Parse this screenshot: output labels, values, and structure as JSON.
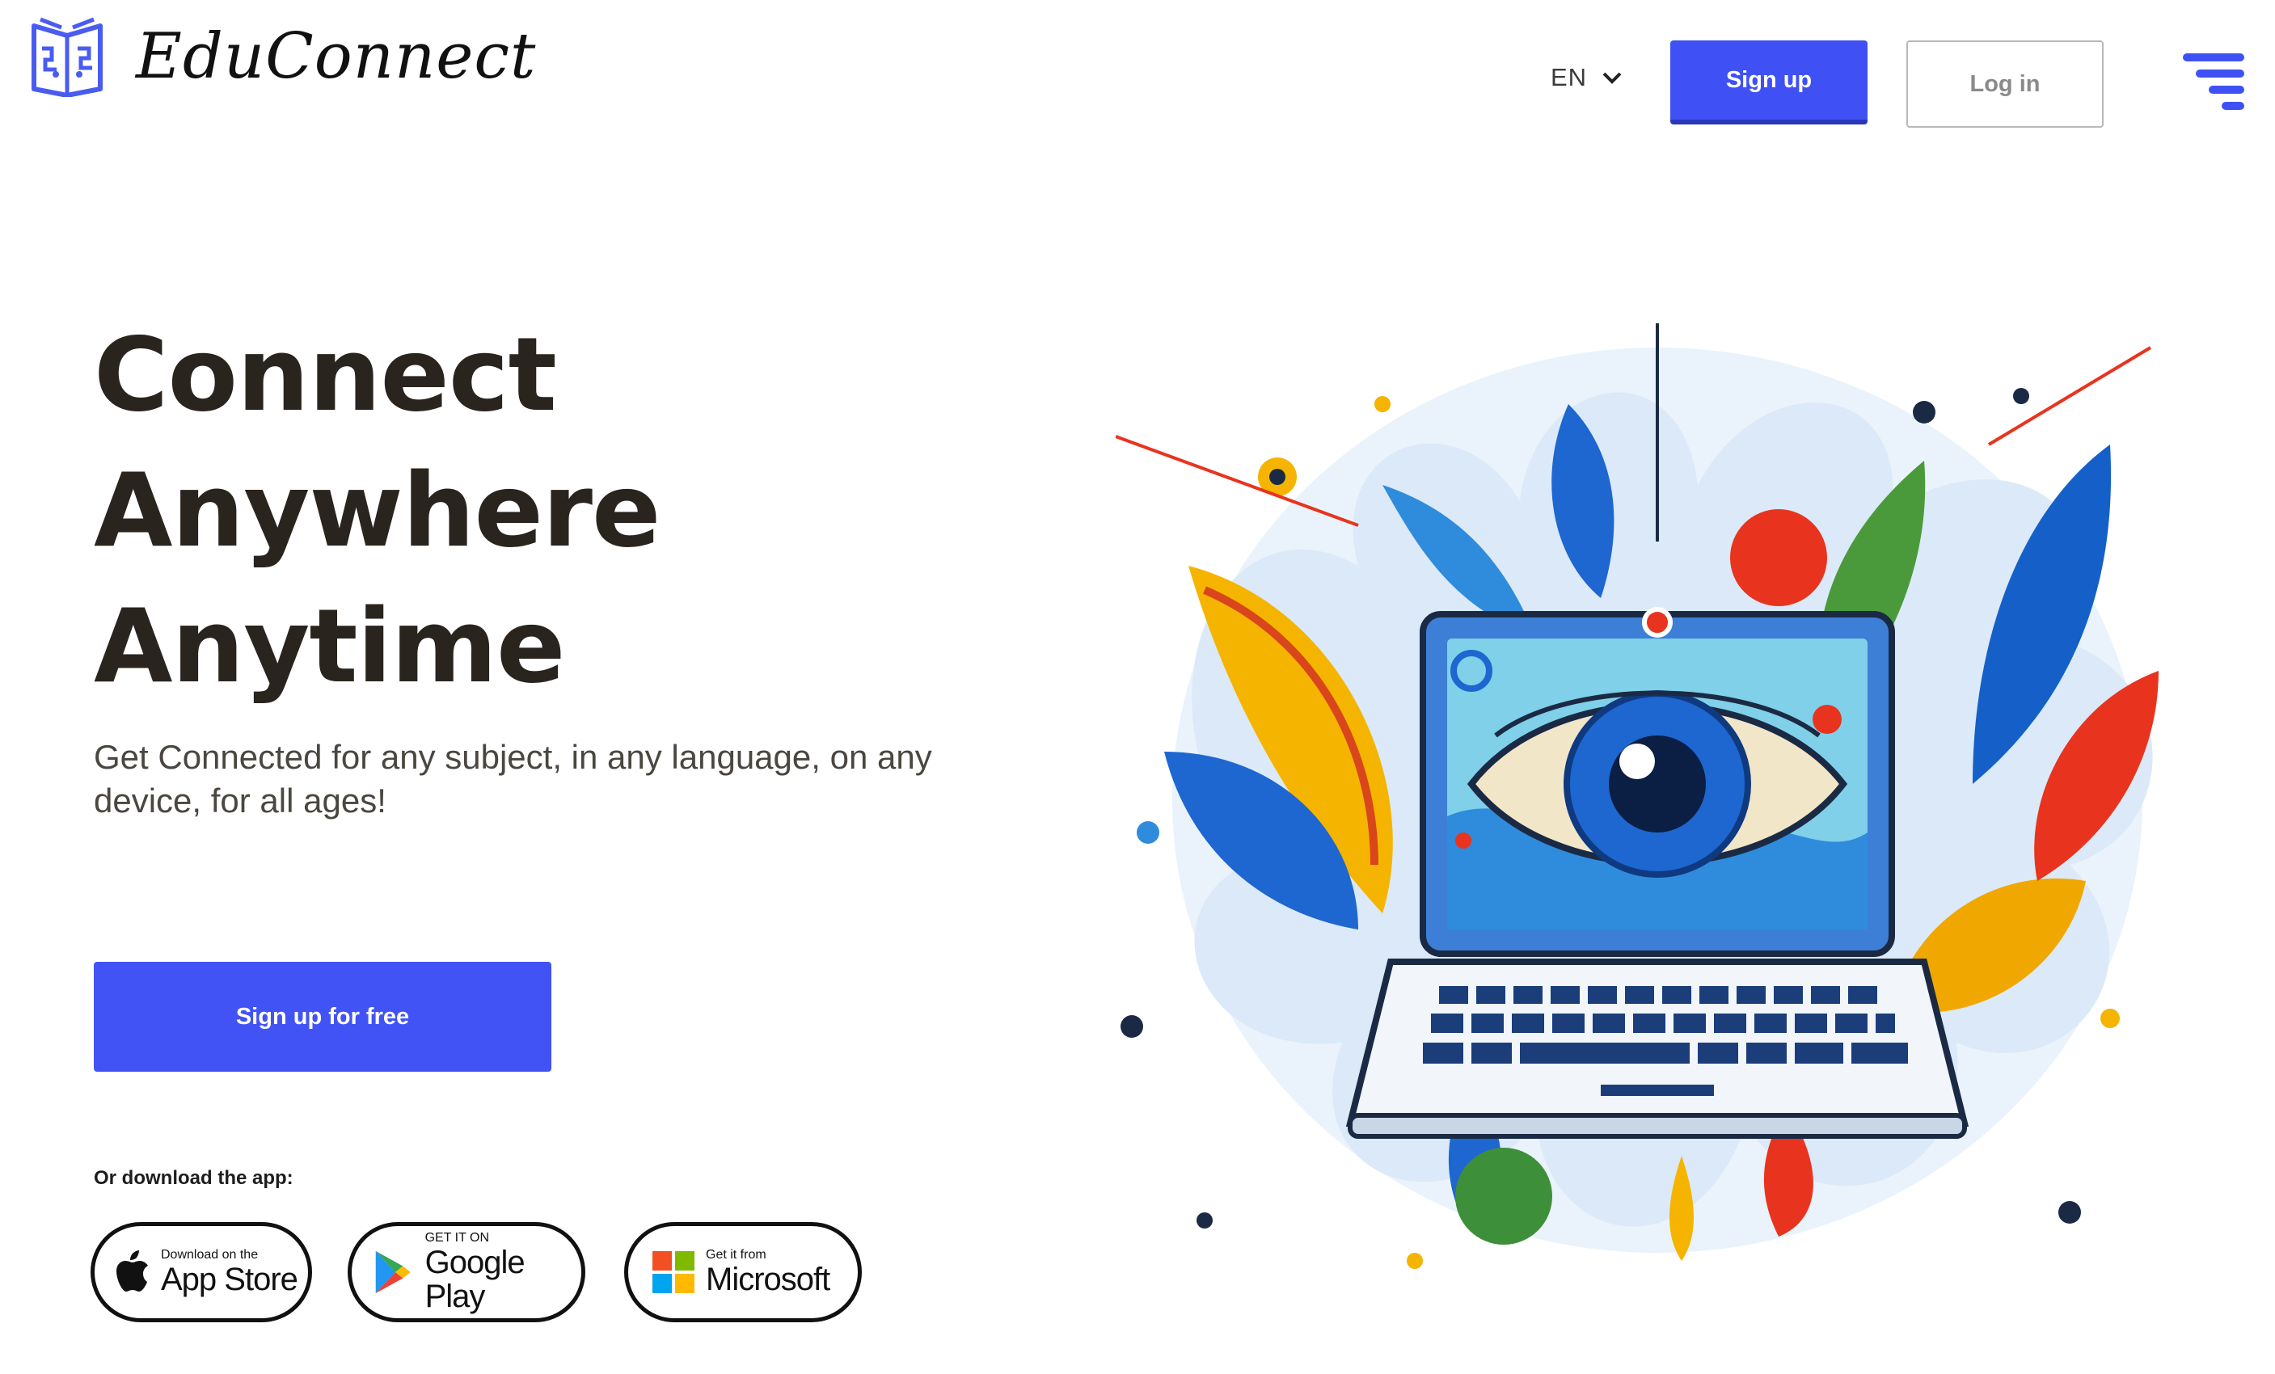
{
  "header": {
    "brand": "EduConnect",
    "language": "EN",
    "signup_label": "Sign up",
    "login_label": "Log in",
    "accent_color": "#3f51f4"
  },
  "hero": {
    "title_lines": [
      "Connect",
      "Anywhere",
      "Anytime"
    ],
    "subtitle": "Get Connected for any subject, in any language, on any device, for all ages!",
    "cta_label": "Sign up for free",
    "download_label": "Or download the app:"
  },
  "stores": {
    "apple": {
      "small": "Download on the",
      "big": "App Store",
      "icon": "apple-icon"
    },
    "google": {
      "small": "GET IT ON",
      "big": "Google Play",
      "icon": "google-play-icon"
    },
    "microsoft": {
      "small": "Get it from",
      "big": "Microsoft",
      "icon": "microsoft-icon"
    }
  },
  "illustration": {
    "icon": "laptop-eye-illustration"
  }
}
